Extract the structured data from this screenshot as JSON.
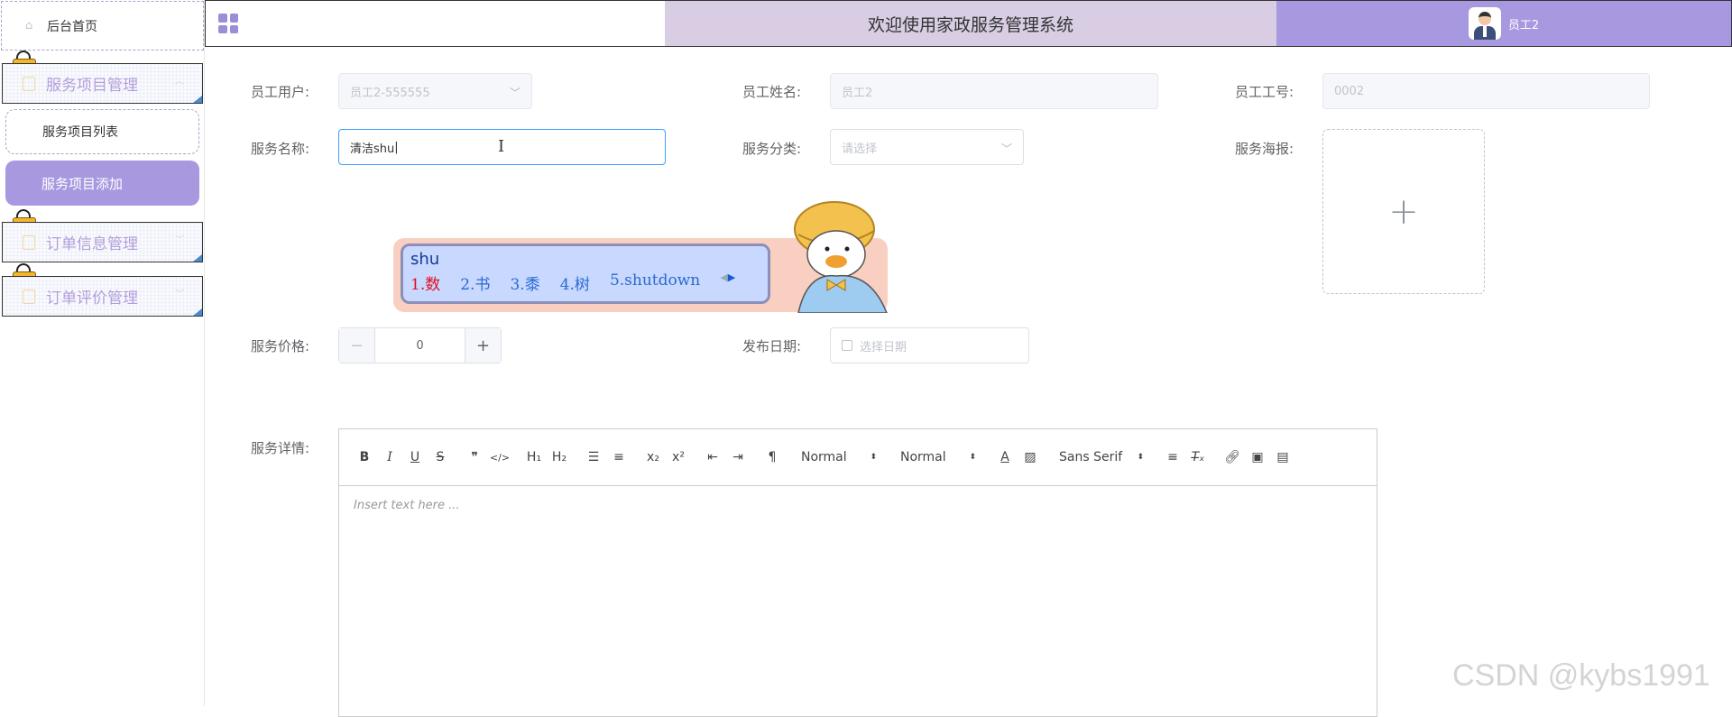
{
  "sidebar": {
    "home_label": "后台首页",
    "groups": [
      {
        "label": "服务项目管理"
      },
      {
        "label": "订单信息管理"
      },
      {
        "label": "订单评价管理"
      }
    ],
    "sub_items": [
      {
        "label": "服务项目列表"
      },
      {
        "label": "服务项目添加"
      }
    ]
  },
  "header": {
    "title": "欢迎使用家政服务管理系统",
    "user_name": "员工2"
  },
  "form": {
    "employee_user": {
      "label": "员工用户:",
      "value": "员工2-555555"
    },
    "employee_name": {
      "label": "员工姓名:",
      "value": "员工2"
    },
    "employee_no": {
      "label": "员工工号:",
      "value": "0002"
    },
    "service_name": {
      "label": "服务名称:",
      "value": "清洁shu"
    },
    "service_category": {
      "label": "服务分类:",
      "placeholder": "请选择"
    },
    "service_poster": {
      "label": "服务海报:"
    },
    "service_price": {
      "label": "服务价格:",
      "value": "0"
    },
    "publish_date": {
      "label": "发布日期:",
      "placeholder": "选择日期"
    },
    "service_detail": {
      "label": "服务详情:"
    }
  },
  "editor": {
    "header_picker": "Normal",
    "size_picker": "Normal",
    "font_picker": "Sans Serif",
    "placeholder": "Insert text here ..."
  },
  "ime": {
    "input": "shu",
    "candidates": [
      "1.数",
      "2.书",
      "3.黍",
      "4.树",
      "5.shutdown"
    ]
  },
  "watermark": "CSDN @kybs1991"
}
